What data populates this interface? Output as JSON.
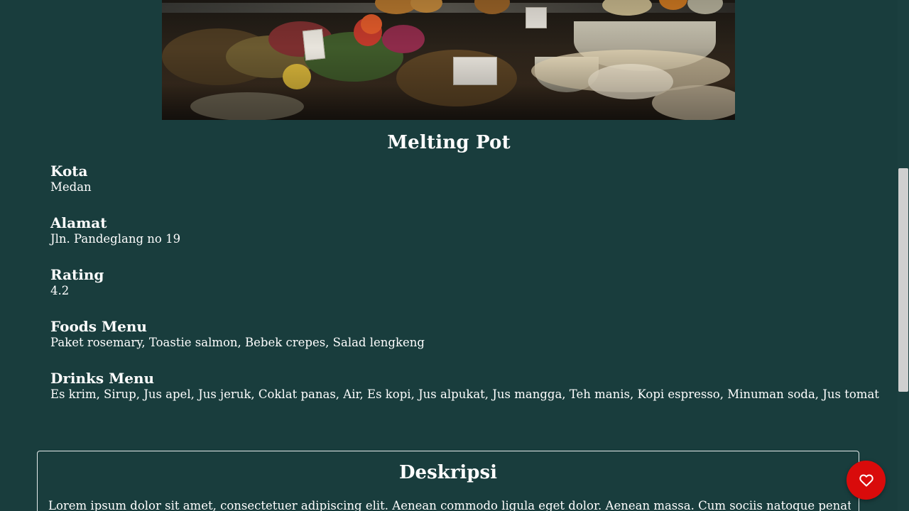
{
  "restaurant": {
    "name": "Melting Pot"
  },
  "details": [
    {
      "label": "Kota",
      "value": "Medan"
    },
    {
      "label": "Alamat",
      "value": "Jln. Pandeglang no 19"
    },
    {
      "label": "Rating",
      "value": "4.2"
    },
    {
      "label": "Foods Menu",
      "value": "Paket rosemary, Toastie salmon, Bebek crepes, Salad lengkeng"
    },
    {
      "label": "Drinks Menu",
      "value": "Es krim, Sirup, Jus apel, Jus jeruk, Coklat panas, Air, Es kopi, Jus alpukat, Jus mangga, Teh manis, Kopi espresso, Minuman soda, Jus tomat"
    }
  ],
  "description": {
    "title": "Deskripsi",
    "text": "Lorem ipsum dolor sit amet, consectetuer adipiscing elit. Aenean commodo ligula eget dolor. Aenean massa. Cum sociis natoque penatibus et"
  },
  "favorite_button": {
    "icon": "heart-icon"
  },
  "colors": {
    "background": "#193d3d",
    "text": "#ffffff",
    "favorite": "#d90b0b",
    "scrollbar_thumb": "#cfcfcf"
  }
}
